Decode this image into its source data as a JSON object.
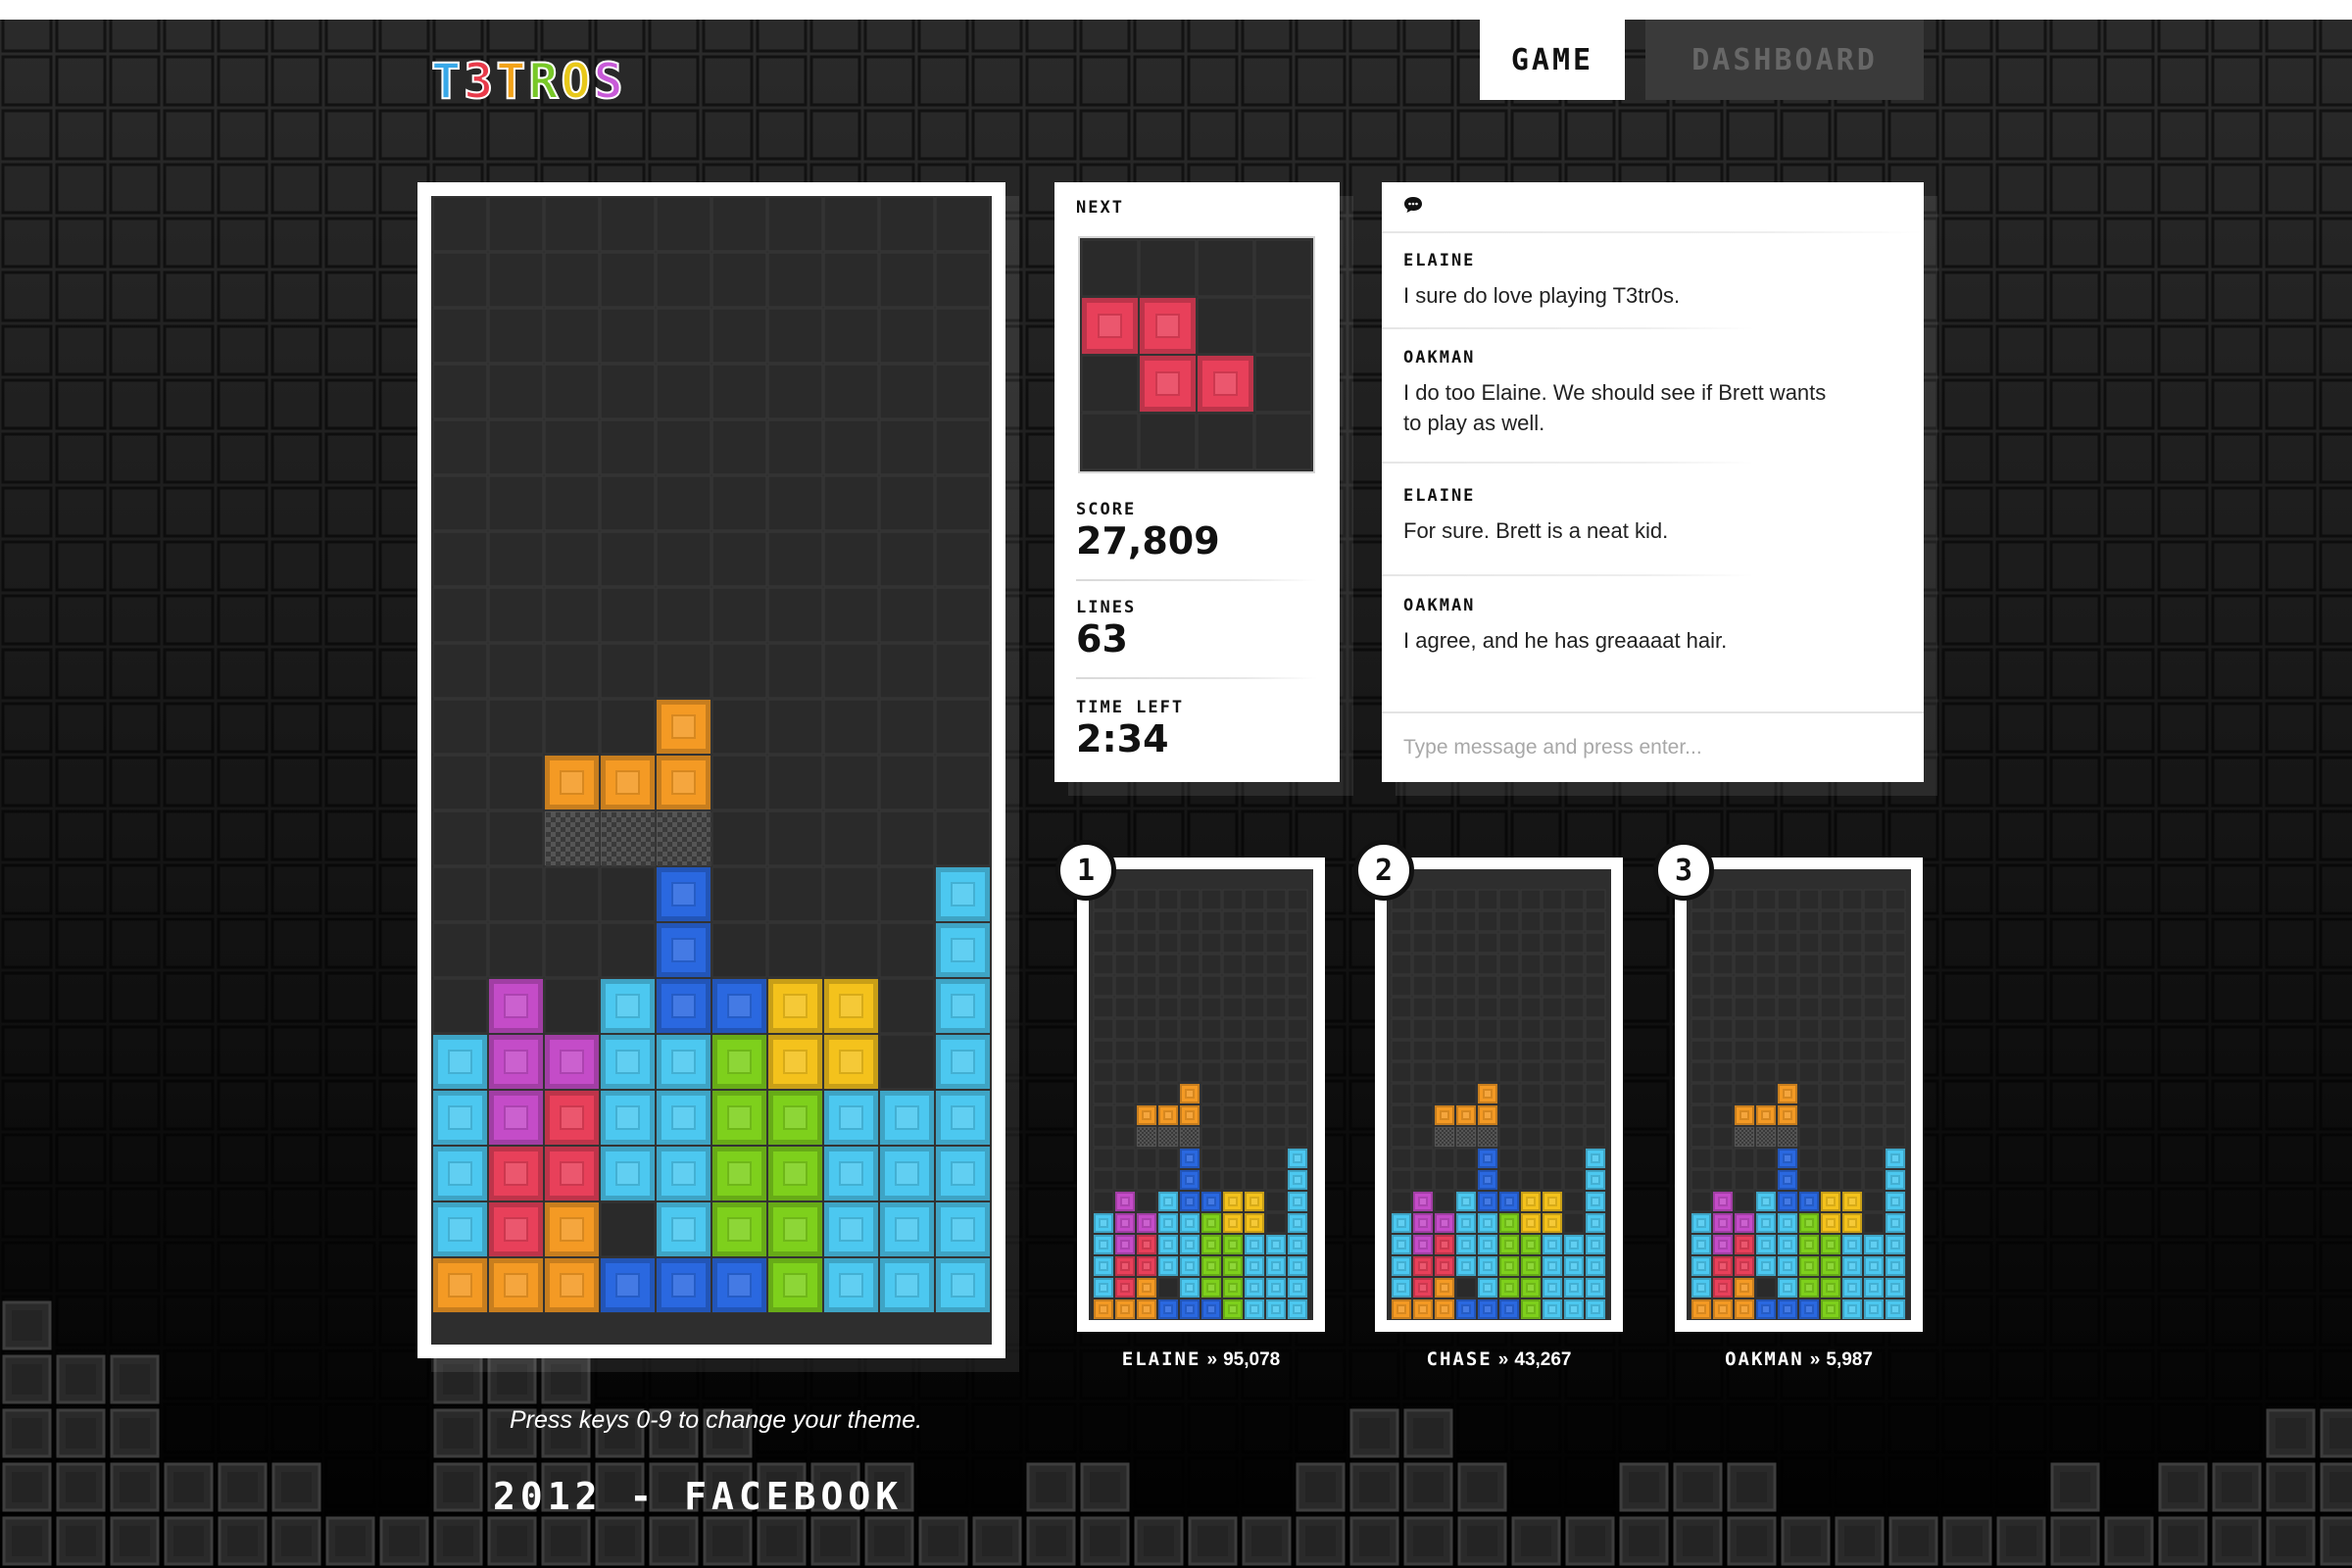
{
  "logo": {
    "text": "T3TROS",
    "colors": [
      "#38a8e8",
      "#e83a4a",
      "#f2a218",
      "#78c828",
      "#e8c81a",
      "#c85ad8"
    ]
  },
  "nav": {
    "game_label": "GAME",
    "dashboard_label": "DASHBOARD",
    "active": "game"
  },
  "board": {
    "cols": 10,
    "rows": 20,
    "cells": [
      "..........",
      "..........",
      "..........",
      "..........",
      "..........",
      "..........",
      "..........",
      "..........",
      "..........",
      "..........",
      "..........",
      "..........",
      "..........",
      "....O.....",
      "..OOO.....",
      "..GGG.....",
      "....B....C",
      "....B....C",
      ".P.CBBYY.C",
      "CPPCCLYY.C",
      "CPRCCLLCCC",
      "CRRCCLLCCC",
      "CRO.CLLCCC",
      "OOOBBBLCCC"
    ]
  },
  "stats": {
    "next_label": "NEXT",
    "next_piece": {
      "cells": [
        "....",
        "RR..",
        ".RR.",
        "...."
      ]
    },
    "score_label": "SCORE",
    "score": "27,809",
    "lines_label": "LINES",
    "lines": "63",
    "time_label": "TIME LEFT",
    "time": "2:34"
  },
  "chat": {
    "icon": "chat-bubble-icon",
    "messages": [
      {
        "name": "ELAINE",
        "text": "I sure do love playing T3tr0s."
      },
      {
        "name": "OAKMAN",
        "text": "I do too Elaine.  We should see if Brett wants to play as well."
      },
      {
        "name": "ELAINE",
        "text": "For sure.  Brett is a neat kid."
      },
      {
        "name": "OAKMAN",
        "text": "I agree, and he has greaaaat hair."
      }
    ],
    "input_value": "",
    "input_placeholder": "Type message and press enter..."
  },
  "leaderboard": [
    {
      "rank": "1",
      "name": "ELAINE",
      "separator": "»",
      "score": "95,078"
    },
    {
      "rank": "2",
      "name": "CHASE",
      "separator": "»",
      "score": "43,267"
    },
    {
      "rank": "3",
      "name": "OAKMAN",
      "separator": "»",
      "score": "5,987"
    }
  ],
  "theme_hint": "Press keys 0-9 to change your theme.",
  "footer": "2012 - FACEBOOK",
  "colors": {
    "cyan": "#4cc8f0",
    "orange": "#f49a24",
    "blue": "#2a68e0",
    "magenta": "#c44cc8",
    "red": "#e8405a",
    "yellow": "#f4c21c",
    "lime": "#7ed01c",
    "ghost": "#4a4a4a",
    "board": "#2e2e2e"
  }
}
